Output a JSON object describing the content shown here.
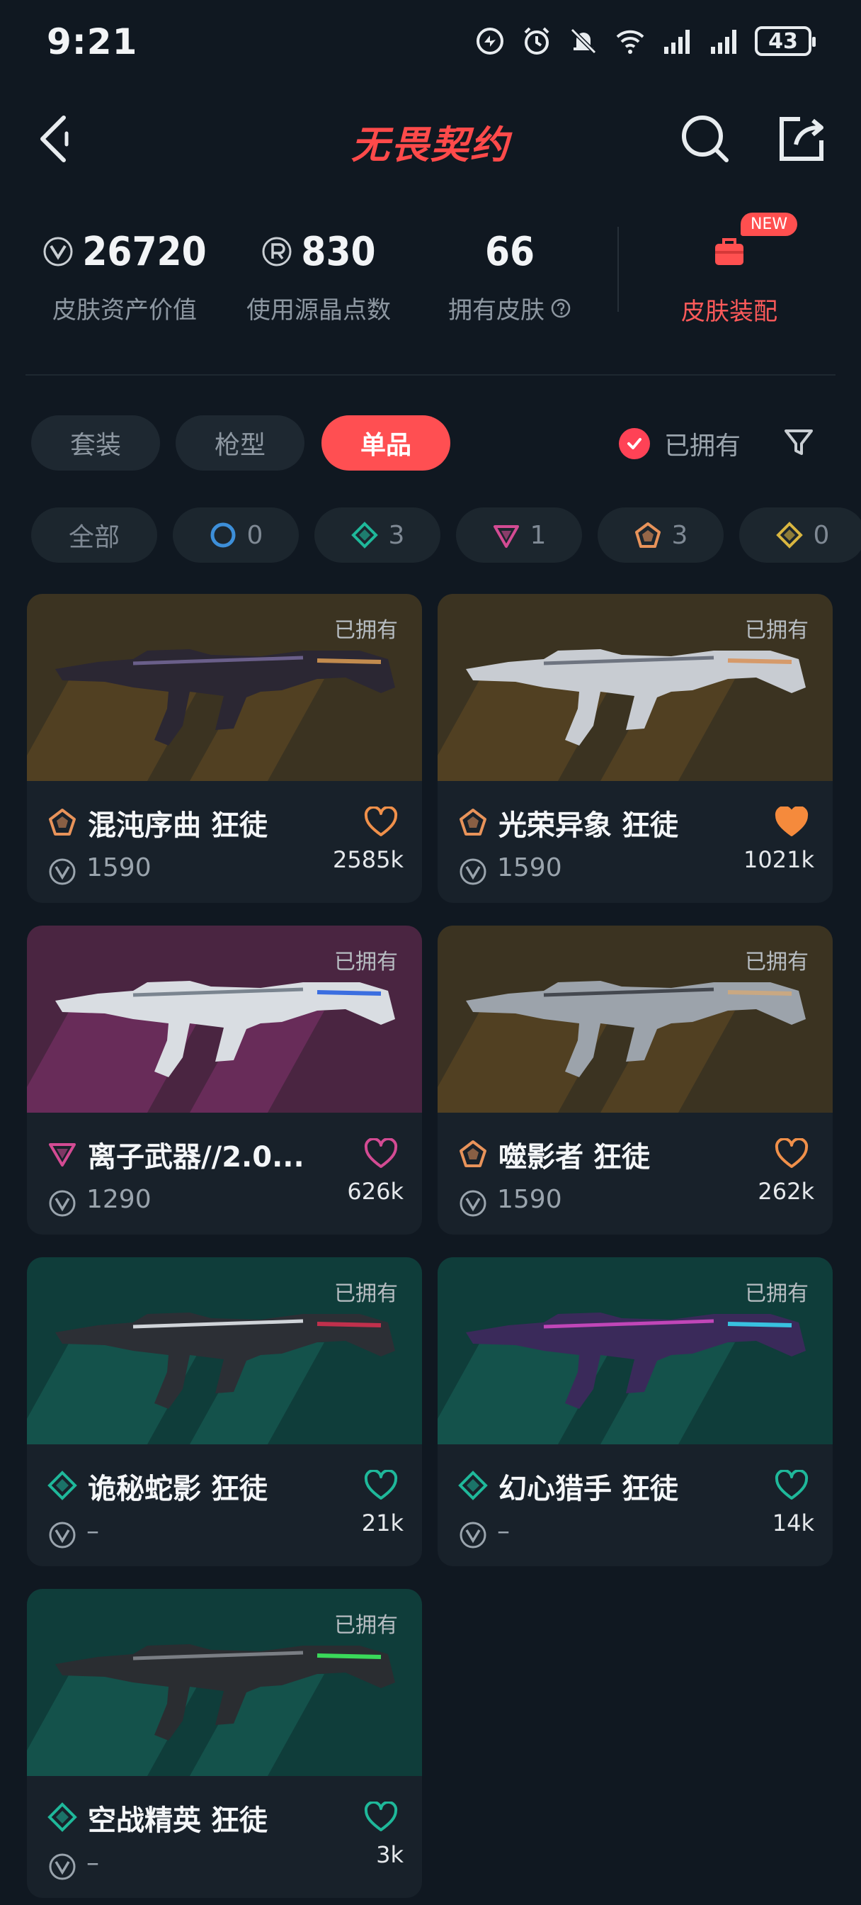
{
  "status_bar": {
    "time": "9:21",
    "battery": "43"
  },
  "header": {
    "title": "无畏契约"
  },
  "stats": [
    {
      "value": "26720",
      "label": "皮肤资产价值",
      "icon": "vp-coin-icon"
    },
    {
      "value": "830",
      "label": "使用源晶点数",
      "icon": "radianite-icon"
    },
    {
      "value": "66",
      "label": "拥有皮肤",
      "icon": "help-circle-icon"
    }
  ],
  "loadout": {
    "badge": "NEW",
    "label": "皮肤装配"
  },
  "tabs": [
    "套装",
    "枪型",
    "单品"
  ],
  "active_tab": "单品",
  "owned_filter": {
    "label": "已拥有",
    "checked": true
  },
  "chips": [
    {
      "label": "全部"
    },
    {
      "count": "0",
      "tier": "select",
      "color": "#3d8fd9"
    },
    {
      "count": "3",
      "tier": "deluxe",
      "color": "#1fb89a"
    },
    {
      "count": "1",
      "tier": "premium",
      "color": "#d34b93"
    },
    {
      "count": "3",
      "tier": "exclusive",
      "color": "#e8935a"
    },
    {
      "count": "0",
      "tier": "ultra",
      "color": "#d9b640"
    }
  ],
  "cards": [
    {
      "name": "混沌序曲 狂徒",
      "price": "1590",
      "likes": "2585k",
      "owned_tag": "已拥有",
      "tier": "exclusive",
      "tier_color": "#e8935a",
      "heart_color": "#f0904a",
      "heart_filled": false,
      "bg": "gold"
    },
    {
      "name": "光荣异象 狂徒",
      "price": "1590",
      "likes": "1021k",
      "owned_tag": "已拥有",
      "tier": "exclusive",
      "tier_color": "#e8935a",
      "heart_color": "#f58a3c",
      "heart_filled": true,
      "bg": "gold"
    },
    {
      "name": "离子武器//2.0...",
      "price": "1290",
      "likes": "626k",
      "owned_tag": "已拥有",
      "tier": "premium",
      "tier_color": "#d34b93",
      "heart_color": "#d34b93",
      "heart_filled": false,
      "bg": "purple"
    },
    {
      "name": "噬影者 狂徒",
      "price": "1590",
      "likes": "262k",
      "owned_tag": "已拥有",
      "tier": "exclusive",
      "tier_color": "#e8935a",
      "heart_color": "#f0904a",
      "heart_filled": false,
      "bg": "gold"
    },
    {
      "name": "诡秘蛇影 狂徒",
      "price": "–",
      "likes": "21k",
      "owned_tag": "已拥有",
      "tier": "deluxe",
      "tier_color": "#1fb89a",
      "heart_color": "#1fb89a",
      "heart_filled": false,
      "bg": "teal"
    },
    {
      "name": "幻心猎手 狂徒",
      "price": "–",
      "likes": "14k",
      "owned_tag": "已拥有",
      "tier": "deluxe",
      "tier_color": "#1fb89a",
      "heart_color": "#1fb89a",
      "heart_filled": false,
      "bg": "teal"
    },
    {
      "name": "空战精英 狂徒",
      "price": "–",
      "likes": "3k",
      "owned_tag": "已拥有",
      "tier": "deluxe",
      "tier_color": "#1fb89a",
      "heart_color": "#1fb89a",
      "heart_filled": false,
      "bg": "teal"
    }
  ]
}
